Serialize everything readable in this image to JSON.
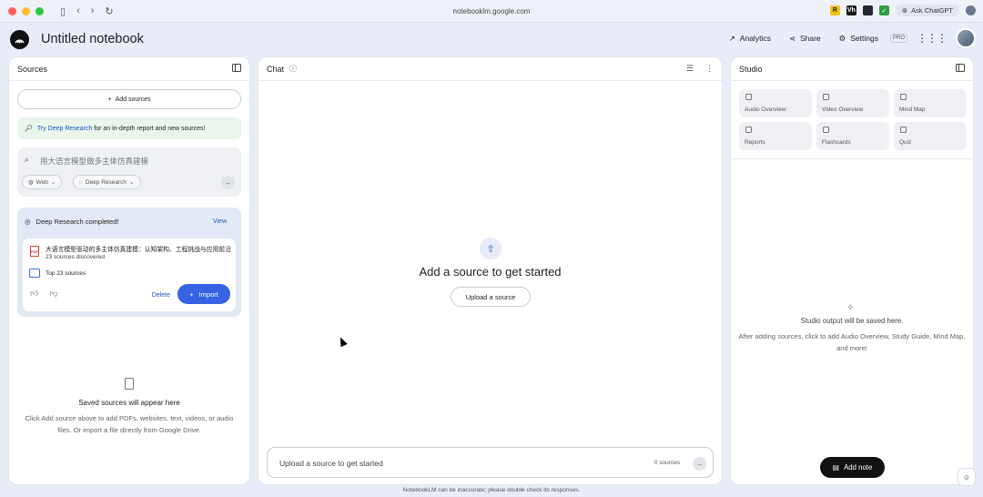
{
  "browser": {
    "url": "notebooklm.google.com",
    "ask_chatgpt": "Ask ChatGPT",
    "extensions": [
      {
        "icon": "r-extension-icon",
        "label": "R",
        "color": "#f5c518"
      },
      {
        "icon": "vh-extension-icon",
        "label": "Vh",
        "color": "#1a1a1a"
      },
      {
        "icon": "github-extension-icon",
        "label": "",
        "color": "#24292e"
      },
      {
        "icon": "check-extension-icon",
        "label": "✓",
        "color": "#2ea043"
      }
    ]
  },
  "header": {
    "title": "Untitled notebook",
    "analytics": "Analytics",
    "share": "Share",
    "settings": "Settings",
    "pro": "PRO"
  },
  "sources": {
    "title": "Sources",
    "add_sources": "Add sources",
    "try_link": "Try Deep Research",
    "try_text": "for an in-depth report and new sources!",
    "search_placeholder": "用大语言模型做多主体仿真建模",
    "chip_web": "Web",
    "chip_research": "Deep Research",
    "deep_research": {
      "title": "Deep Research completed!",
      "view": "View",
      "doc_title": "大语言模型驱动的多主体仿真建模：认知架构、工程挑战与应用前沿",
      "doc_count": "23 sources discovered",
      "top_sources": "Top 23 sources",
      "delete": "Delete",
      "import": "Import"
    },
    "saved_title": "Saved sources will appear here",
    "saved_desc": "Click Add source above to add PDFs, websites, text, videos, or audio files. Or import a file directly from Google Drive."
  },
  "chat": {
    "title": "Chat",
    "empty_title": "Add a source to get started",
    "upload_button": "Upload a source",
    "input_placeholder": "Upload a source to get started",
    "source_count": "0 sources"
  },
  "studio": {
    "title": "Studio",
    "tiles": [
      {
        "label": "Audio Overview",
        "icon": "audio-icon"
      },
      {
        "label": "Video Overview",
        "icon": "video-icon"
      },
      {
        "label": "Mind Map",
        "icon": "mind-map-icon"
      },
      {
        "label": "Reports",
        "icon": "reports-icon"
      },
      {
        "label": "Flashcards",
        "icon": "flashcards-icon"
      },
      {
        "label": "Quiz",
        "icon": "quiz-icon"
      }
    ],
    "empty_title": "Studio output will be saved here.",
    "empty_desc": "After adding sources, click to add Audio Overview, Study Guide, Mind Map, and more!",
    "add_note": "Add note"
  },
  "footer": "NotebookLM can be inaccurate; please double check its responses.",
  "colors": {
    "accent": "#3662e3",
    "link": "#1a56c4",
    "background": "#e9edf7"
  }
}
